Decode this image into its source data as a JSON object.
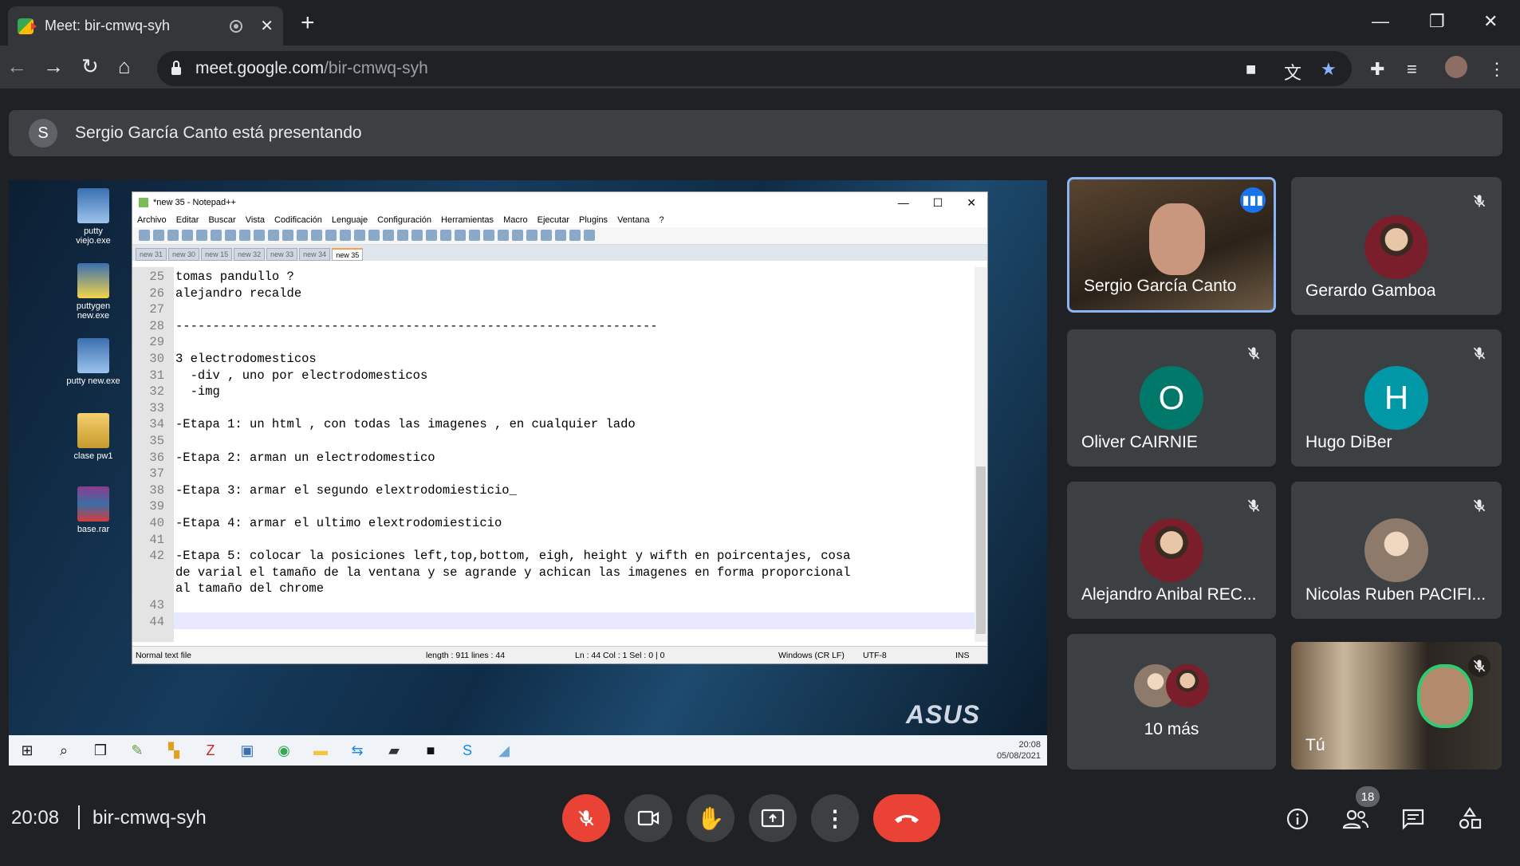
{
  "browser": {
    "tab_title": "Meet: bir-cmwq-syh",
    "tab_close": "✕",
    "new_tab": "+",
    "url_host": "meet.google.com",
    "url_path": "/bir-cmwq-syh"
  },
  "presenting": {
    "avatar_letter": "S",
    "text": "Sergio García Canto está presentando"
  },
  "desktop": {
    "icons": [
      {
        "label": "putty viejo.exe"
      },
      {
        "label": "puttygen new.exe"
      },
      {
        "label": "putty new.exe"
      },
      {
        "label": "clase pw1"
      },
      {
        "label": "base.rar"
      }
    ],
    "brand": "ASUS",
    "clock_time": "20:08",
    "clock_date": "05/08/2021"
  },
  "notepad": {
    "title": "*new 35 - Notepad++",
    "menu": [
      "Archivo",
      "Editar",
      "Buscar",
      "Vista",
      "Codificación",
      "Lenguaje",
      "Configuración",
      "Herramientas",
      "Macro",
      "Ejecutar",
      "Plugins",
      "Ventana",
      "?"
    ],
    "tabs": [
      "new 31",
      "new 30",
      "new 15",
      "new 32",
      "new 33",
      "new 34",
      "new 35"
    ],
    "active_tab": "new 35",
    "lines": [
      {
        "n": "25",
        "t": "tomas pandullo ?"
      },
      {
        "n": "26",
        "t": "alejandro recalde"
      },
      {
        "n": "27",
        "t": ""
      },
      {
        "n": "28",
        "t": "-----------------------------------------------------------------"
      },
      {
        "n": "29",
        "t": ""
      },
      {
        "n": "30",
        "t": "3 electrodomesticos"
      },
      {
        "n": "31",
        "t": "  -div , uno por electrodomesticos"
      },
      {
        "n": "32",
        "t": "  -img"
      },
      {
        "n": "33",
        "t": ""
      },
      {
        "n": "34",
        "t": "-Etapa 1: un html , con todas las imagenes , en cualquier lado"
      },
      {
        "n": "35",
        "t": ""
      },
      {
        "n": "36",
        "t": "-Etapa 2: arman un electrodomestico"
      },
      {
        "n": "37",
        "t": ""
      },
      {
        "n": "38",
        "t": "-Etapa 3: armar el segundo elextrodomiesticio_"
      },
      {
        "n": "39",
        "t": ""
      },
      {
        "n": "40",
        "t": "-Etapa 4: armar el ultimo elextrodomiesticio"
      },
      {
        "n": "41",
        "t": ""
      },
      {
        "n": "42",
        "t": "-Etapa 5: colocar la posiciones left,top,bottom, eigh, height y wifth en poircentajes, cosa"
      },
      {
        "n": "",
        "t": "de varial el tamaño de la ventana y se agrande y achican las imagenes en forma proporcional"
      },
      {
        "n": "",
        "t": "al tamaño del chrome"
      },
      {
        "n": "43",
        "t": ""
      },
      {
        "n": "44",
        "t": ""
      }
    ],
    "status": {
      "type": "Normal text file",
      "length": "length : 911    lines : 44",
      "pos": "Ln : 44    Col : 1    Sel : 0 | 0",
      "eol": "Windows (CR LF)",
      "enc": "UTF-8",
      "mode": "INS"
    }
  },
  "participants": [
    {
      "name": "Sergio García Canto",
      "kind": "video",
      "speaking": true
    },
    {
      "name": "Gerardo Gamboa",
      "kind": "photo",
      "muted": true
    },
    {
      "name": "Oliver CAIRNIE",
      "kind": "letter",
      "letter": "O",
      "color": "#00796b",
      "muted": true
    },
    {
      "name": "Hugo DiBer",
      "kind": "letter",
      "letter": "H",
      "color": "#0097a7",
      "muted": true
    },
    {
      "name": "Alejandro Anibal REC...",
      "kind": "photo",
      "muted": true
    },
    {
      "name": "Nicolas Ruben PACIFI...",
      "kind": "photo",
      "muted": true
    },
    {
      "name": "10 más",
      "kind": "more"
    },
    {
      "name": "Tú",
      "kind": "self",
      "muted": true
    }
  ],
  "footer": {
    "time": "20:08",
    "meeting_code": "bir-cmwq-syh",
    "participant_count": "18"
  },
  "colors": {
    "danger": "#ea4335",
    "accent": "#8ab4f8",
    "tile_bg": "#3c4043"
  }
}
